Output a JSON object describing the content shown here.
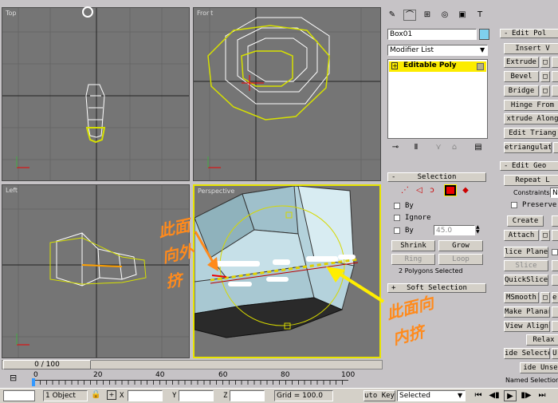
{
  "viewports": {
    "top": {
      "label": "Top"
    },
    "front": {
      "label": "Front"
    },
    "left": {
      "label": "Left"
    },
    "perspective": {
      "label": "Perspective"
    }
  },
  "annotations": {
    "left_note_line1": "此面",
    "left_note_line2": "向外",
    "left_note_line3": "挤",
    "right_note_line1": "此面向",
    "right_note_line2": "内挤",
    "color": "#ff8a1c"
  },
  "command_panel": {
    "object_name": "Box01",
    "modifier_list": "Modifier List",
    "stack_item": "Editable Poly"
  },
  "selection_rollout": {
    "title": "Selection",
    "by_vertex": "By",
    "ignore": "Ignore",
    "by_angle": "By",
    "angle_value": "45.0",
    "shrink": "Shrink",
    "grow": "Grow",
    "ring": "Ring",
    "loop": "Loop",
    "status": "2 Polygons Selected"
  },
  "soft_selection": {
    "title": "Soft Selection"
  },
  "edit_poly_rollout": {
    "title": "Edit Pol",
    "insert": "Insert V",
    "extrude": "Extrude",
    "bevel": "Bevel",
    "bridge": "Bridge",
    "hinge": "Hinge From",
    "extrude_along": "xtrude Along",
    "edit_tri": "Edit Triang",
    "retri": "etriangulat"
  },
  "edit_geo_rollout": {
    "title": "Edit Geo",
    "repeat": "Repeat L",
    "constraints": "Constraints:",
    "constraints_value": "N",
    "preserve": "Preserve",
    "create": "Create",
    "attach": "Attach",
    "slice_plane": "lice Plane",
    "slice": "Slice",
    "quickslice": "QuickSlice",
    "msmooth": "MSmooth",
    "msmooth_right": "e:",
    "make_planar": "Make Planar",
    "view_align": "View Align",
    "relax": "Relax",
    "hide_selected": "ide Selecte",
    "hide_right": "Ur",
    "unhide": "ide Unse",
    "named_sel": "Named Selections"
  },
  "timeline": {
    "frame": "0 / 100",
    "ruler": [
      "0",
      "20",
      "40",
      "60",
      "80",
      "100"
    ]
  },
  "status_bar": {
    "objects": "1 Object",
    "x_label": "X",
    "y_label": "Y",
    "z_label": "Z",
    "grid": "Grid = 100.0",
    "auto_key": "uto Key",
    "selected": "Selected"
  }
}
